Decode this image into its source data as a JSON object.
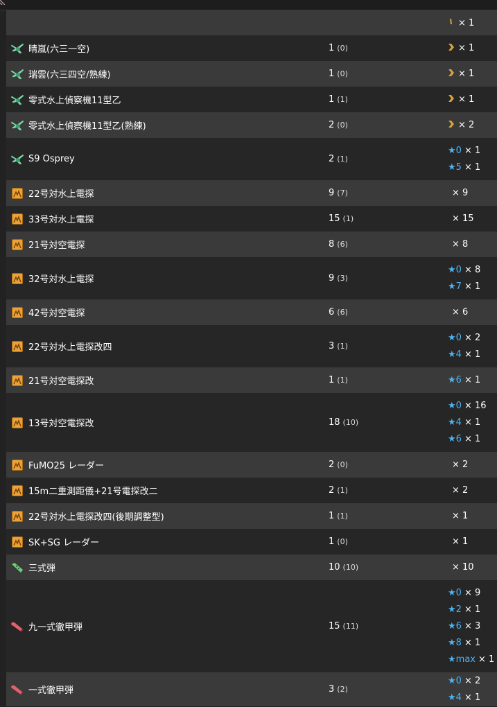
{
  "colors": {
    "background": "#222222",
    "row_light": "#3a3a3a",
    "row_dark": "#262626",
    "star": "#4fb3f0",
    "proficiency": "#d9a33a",
    "radar": "#e8a33a"
  },
  "rows": [
    {
      "icon": "",
      "name": "",
      "count": "",
      "sub": "",
      "stars": [
        {
          "type": "proficiency-small",
          "label": "",
          "mult": "× 1"
        }
      ]
    },
    {
      "icon": "seaplane-icon",
      "name": "晴嵐(六三一空)",
      "count": "1",
      "sub": "(0)",
      "stars": [
        {
          "type": "proficiency",
          "label": "",
          "mult": "× 1"
        }
      ]
    },
    {
      "icon": "seaplane-icon",
      "name": "瑞雲(六三四空/熟練)",
      "count": "1",
      "sub": "(0)",
      "stars": [
        {
          "type": "proficiency",
          "label": "",
          "mult": "× 1"
        }
      ]
    },
    {
      "icon": "seaplane-icon",
      "name": "零式水上偵察機11型乙",
      "count": "1",
      "sub": "(1)",
      "stars": [
        {
          "type": "proficiency",
          "label": "",
          "mult": "× 1"
        }
      ]
    },
    {
      "icon": "seaplane-icon",
      "name": "零式水上偵察機11型乙(熟練)",
      "count": "2",
      "sub": "(0)",
      "stars": [
        {
          "type": "proficiency",
          "label": "",
          "mult": "× 2"
        }
      ]
    },
    {
      "icon": "seaplane-icon",
      "name": "S9 Osprey",
      "count": "2",
      "sub": "(1)",
      "stars": [
        {
          "type": "star",
          "label": "★0",
          "mult": "× 1"
        },
        {
          "type": "star",
          "label": "★5",
          "mult": "× 1"
        }
      ]
    },
    {
      "icon": "radar-icon",
      "name": "22号対水上電探",
      "count": "9",
      "sub": "(7)",
      "stars": [
        {
          "type": "none",
          "label": "",
          "mult": "× 9"
        }
      ]
    },
    {
      "icon": "radar-icon",
      "name": "33号対水上電探",
      "count": "15",
      "sub": "(1)",
      "stars": [
        {
          "type": "none",
          "label": "",
          "mult": "× 15"
        }
      ]
    },
    {
      "icon": "radar-icon",
      "name": "21号対空電探",
      "count": "8",
      "sub": "(6)",
      "stars": [
        {
          "type": "none",
          "label": "",
          "mult": "× 8"
        }
      ]
    },
    {
      "icon": "radar-icon",
      "name": "32号対水上電探",
      "count": "9",
      "sub": "(3)",
      "stars": [
        {
          "type": "star",
          "label": "★0",
          "mult": "× 8"
        },
        {
          "type": "star",
          "label": "★7",
          "mult": "× 1"
        }
      ]
    },
    {
      "icon": "radar-icon",
      "name": "42号対空電探",
      "count": "6",
      "sub": "(6)",
      "stars": [
        {
          "type": "none",
          "label": "",
          "mult": "× 6"
        }
      ]
    },
    {
      "icon": "radar-icon",
      "name": "22号対水上電探改四",
      "count": "3",
      "sub": "(1)",
      "stars": [
        {
          "type": "star",
          "label": "★0",
          "mult": "× 2"
        },
        {
          "type": "star",
          "label": "★4",
          "mult": "× 1"
        }
      ]
    },
    {
      "icon": "radar-icon",
      "name": "21号対空電探改",
      "count": "1",
      "sub": "(1)",
      "stars": [
        {
          "type": "star",
          "label": "★6",
          "mult": "× 1"
        }
      ]
    },
    {
      "icon": "radar-icon",
      "name": "13号対空電探改",
      "count": "18",
      "sub": "(10)",
      "stars": [
        {
          "type": "star",
          "label": "★0",
          "mult": "× 16"
        },
        {
          "type": "star",
          "label": "★4",
          "mult": "× 1"
        },
        {
          "type": "star",
          "label": "★6",
          "mult": "× 1"
        }
      ]
    },
    {
      "icon": "radar-icon",
      "name": "FuMO25 レーダー",
      "count": "2",
      "sub": "(0)",
      "stars": [
        {
          "type": "none",
          "label": "",
          "mult": "× 2"
        }
      ]
    },
    {
      "icon": "radar-icon",
      "name": "15m二重測距儀+21号電探改二",
      "count": "2",
      "sub": "(1)",
      "stars": [
        {
          "type": "none",
          "label": "",
          "mult": "× 2"
        }
      ]
    },
    {
      "icon": "radar-icon",
      "name": "22号対水上電探改四(後期調整型)",
      "count": "1",
      "sub": "(1)",
      "stars": [
        {
          "type": "none",
          "label": "",
          "mult": "× 1"
        }
      ]
    },
    {
      "icon": "radar-icon",
      "name": "SK+SG レーダー",
      "count": "1",
      "sub": "(0)",
      "stars": [
        {
          "type": "none",
          "label": "",
          "mult": "× 1"
        }
      ]
    },
    {
      "icon": "sanshiki-shell-icon",
      "name": "三式弾",
      "count": "10",
      "sub": "(10)",
      "stars": [
        {
          "type": "none",
          "label": "",
          "mult": "× 10"
        }
      ]
    },
    {
      "icon": "ap-shell-icon",
      "name": "九一式徹甲弾",
      "count": "15",
      "sub": "(11)",
      "stars": [
        {
          "type": "star",
          "label": "★0",
          "mult": "× 9"
        },
        {
          "type": "star",
          "label": "★2",
          "mult": "× 1"
        },
        {
          "type": "star",
          "label": "★6",
          "mult": "× 3"
        },
        {
          "type": "star",
          "label": "★8",
          "mult": "× 1"
        },
        {
          "type": "star",
          "label": "★max",
          "mult": "× 1"
        }
      ]
    },
    {
      "icon": "ap-shell-icon",
      "name": "一式徹甲弾",
      "count": "3",
      "sub": "(2)",
      "stars": [
        {
          "type": "star",
          "label": "★0",
          "mult": "× 2"
        },
        {
          "type": "star",
          "label": "★4",
          "mult": "× 1"
        }
      ]
    }
  ]
}
